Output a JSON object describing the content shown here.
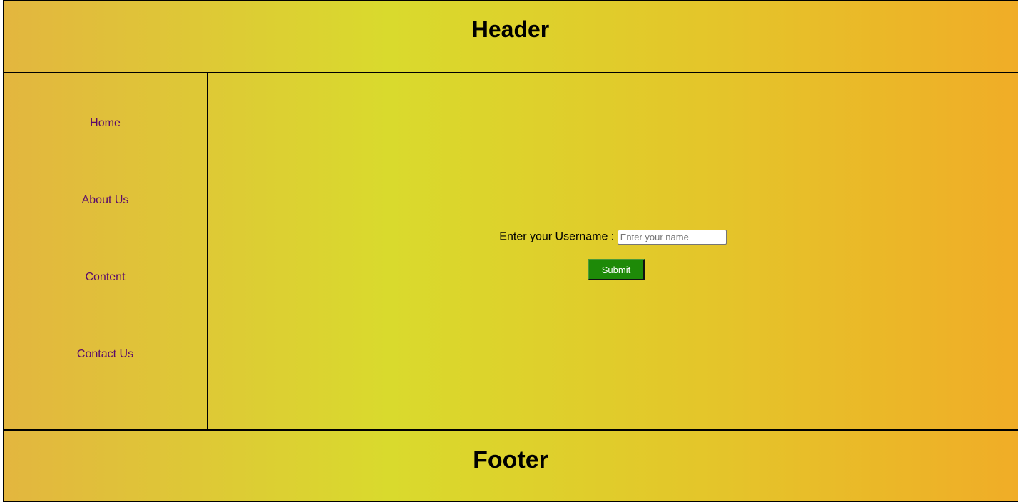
{
  "header": {
    "title": "Header"
  },
  "sidebar": {
    "items": [
      {
        "label": "Home"
      },
      {
        "label": "About Us"
      },
      {
        "label": "Content"
      },
      {
        "label": "Contact Us"
      }
    ]
  },
  "form": {
    "label": "Enter your Username :",
    "placeholder": "Enter your name",
    "value": "",
    "submit_label": "Submit"
  },
  "footer": {
    "title": "Footer"
  },
  "colors": {
    "gradient_left": "#e3b63f",
    "gradient_mid": "#d9da2d",
    "gradient_right": "#f0ad27",
    "link": "#5a0a6b",
    "submit_bg": "#1e8a08"
  }
}
